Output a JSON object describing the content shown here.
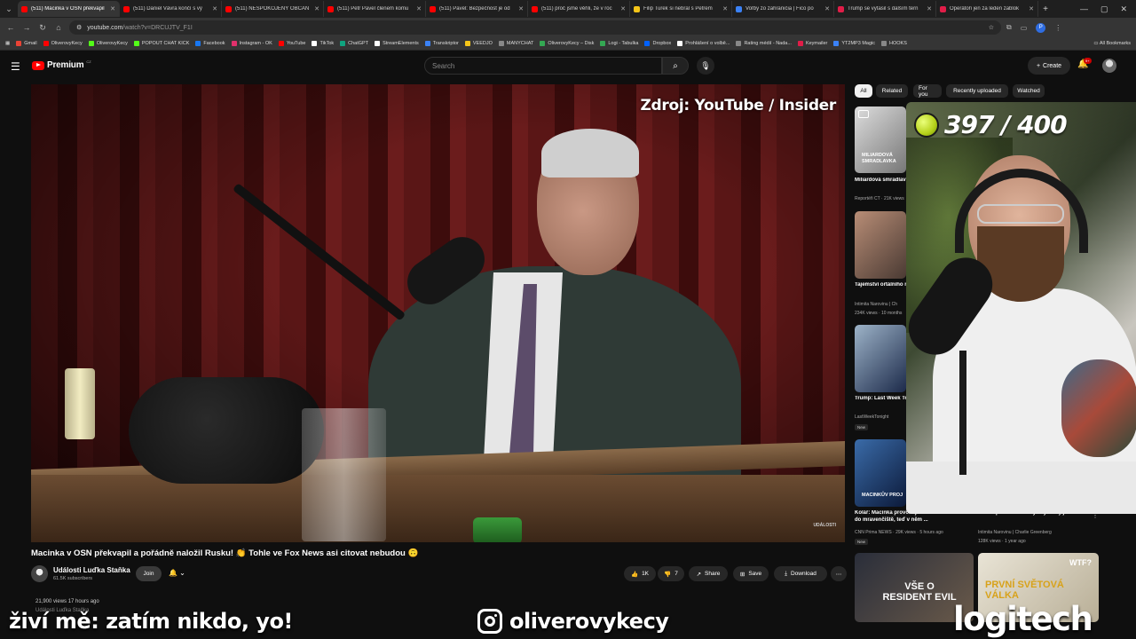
{
  "browser": {
    "tabs": [
      {
        "label": "(511) Macinka v OSN překvapil",
        "active": true,
        "favicon": "youtube-favicon",
        "color": "#ff0000"
      },
      {
        "label": "(511) Daniel Vávra končí s vý",
        "active": false,
        "favicon": "youtube-favicon",
        "color": "#ff0000"
      },
      {
        "label": "(511) NESPOKOJENÝ OBČAN",
        "active": false,
        "favicon": "youtube-favicon",
        "color": "#ff0000"
      },
      {
        "label": "(511) Petr Pavel členem komu",
        "active": false,
        "favicon": "youtube-favicon",
        "color": "#ff0000"
      },
      {
        "label": "(511) Pavel: Bezpečnost je od",
        "active": false,
        "favicon": "youtube-favicon",
        "color": "#ff0000"
      },
      {
        "label": "(511) proč jsme věřili, že v roc",
        "active": false,
        "favicon": "youtube-favicon",
        "color": "#ff0000"
      },
      {
        "label": "Filip Turek si nebral s Petrem",
        "active": false,
        "favicon": "x-favicon",
        "color": "#f5c518"
      },
      {
        "label": "Voľby zo zahraničia | Fico po",
        "active": false,
        "favicon": "page-favicon",
        "color": "#3b82f6"
      },
      {
        "label": "Trump se vytasil s dalším tern",
        "active": false,
        "favicon": "news-favicon",
        "color": "#e11d48"
      },
      {
        "label": "Operátoři jen za leden zablok",
        "active": false,
        "favicon": "news-favicon",
        "color": "#e11d48"
      }
    ],
    "new_tab": "+",
    "window_controls": [
      "—",
      "▢",
      "✕"
    ],
    "url_host": "youtube.com",
    "url_rest": "/watch?v=DRCUJTV_F1I",
    "bookmarks": [
      {
        "label": "Gmail",
        "color": "#ea4335"
      },
      {
        "label": "OliverovyKecy",
        "color": "#ff0000"
      },
      {
        "label": "OliverovyKecy",
        "color": "#53fc18"
      },
      {
        "label": "POPOUT CHAT KICK",
        "color": "#53fc18"
      },
      {
        "label": "Facebook",
        "color": "#1877f2"
      },
      {
        "label": "Instagram - OK",
        "color": "#e1306c"
      },
      {
        "label": "YouTube",
        "color": "#ff0000"
      },
      {
        "label": "TikTok",
        "color": "#ffffff"
      },
      {
        "label": "ChatGPT",
        "color": "#10a37f"
      },
      {
        "label": "StreamElements",
        "color": "#ffffff"
      },
      {
        "label": "Transkriptor",
        "color": "#3b82f6"
      },
      {
        "label": "VEEDJO",
        "color": "#f5c518"
      },
      {
        "label": "MANYCHAT",
        "color": "#888888"
      },
      {
        "label": "OliverovyKecy – Disk",
        "color": "#34a853"
      },
      {
        "label": "Logi - Tabulka",
        "color": "#34a853"
      },
      {
        "label": "Dropbox",
        "color": "#0061ff"
      },
      {
        "label": "Prohlášení o volbě...",
        "color": "#ffffff"
      },
      {
        "label": "Rating médií - Nada...",
        "color": "#888888"
      },
      {
        "label": "Keymailer",
        "color": "#e11d48"
      },
      {
        "label": "YT2MP3 Magic",
        "color": "#3b82f6"
      },
      {
        "label": "HOOKS",
        "color": "#888888"
      }
    ],
    "all_bookmarks": "All Bookmarks"
  },
  "youtube": {
    "logo_text": "Premium",
    "logo_sup": "CZ",
    "search_placeholder": "Search",
    "create_label": "Create",
    "notifications_badge": "9+",
    "video": {
      "overlay_source": "Zdroj: YouTube / Insider",
      "overlay_logo": "UDÁLOSTI",
      "title": "Macinka v OSN překvapil a pořádně naložil Rusku! 👏 Tohle ve Fox News asi citovat nebudou 🙃",
      "channel": "Události Luďka Staňka",
      "subscribers": "61.5K subscribers",
      "join_label": "Join",
      "likes": "1K",
      "dislikes": "7",
      "share_label": "Share",
      "save_label": "Save",
      "download_label": "Download",
      "views_time": "21,900 views  17 hours ago",
      "desc_more": "Události Luďka Staňka"
    },
    "chips": [
      "All",
      "Related",
      "For you",
      "Recently uploaded",
      "Watched"
    ],
    "related": [
      {
        "title": "Miliardová smradlavka: slovenská vláda firmy",
        "thumb_text": "MILIARDOVÁ SMRADLAVKA",
        "meta1": "Reportéři ČT · 21K views"
      },
      {
        "title": "Tajemství ortálního neřeknou a proto to d",
        "meta1": "Intimita Narovinu | Ch",
        "meta2": "234K views · 10 months"
      },
      {
        "title": "Trump: Last Week Tonight with John Oliver (HBO)",
        "meta1": "LastWeekTonight",
        "badge": "New"
      },
      {
        "title": "Kolář: Macinka provokuje. Kdos to naučili do mravenčiště, teď v něm ...",
        "thumb_text": "MACINKŮV PROJ",
        "meta1": "CNN Prima NEWS · 29K views · 5 hours ago",
        "badge": "New"
      }
    ],
    "related_right": {
      "title": "Konec prezidentské výšiny. Vždy je řešení.",
      "meta1": "Intimita Narovinu | Charlie Greenberg",
      "meta2": "128K views · 1 year ago"
    },
    "bottom_thumbs": [
      {
        "text": "VŠE O RESIDENT EVIL"
      },
      {
        "text": "PRVNÍ SVĚTOVÁ VÁLKA",
        "corner": "WTF?"
      }
    ]
  },
  "stream_overlay": {
    "counter": "397 / 400",
    "live_text": "živí mě: zatím nikdo, yo!",
    "instagram": "oliverovykecy",
    "sponsor": "logitech"
  }
}
